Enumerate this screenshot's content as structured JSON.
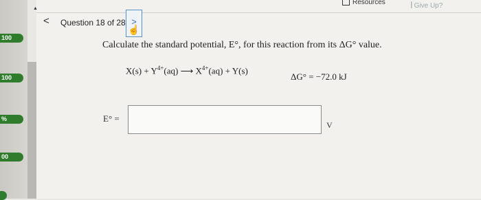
{
  "sidebar": {
    "scores": [
      "100",
      "100",
      "%",
      "00",
      ""
    ]
  },
  "header": {
    "resources_label": "Resources",
    "giveup_label": "Give Up?"
  },
  "nav": {
    "back_glyph": "<",
    "question_label": "Question 18 of 28",
    "next_glyph": ">"
  },
  "question": {
    "prompt": "Calculate the standard potential, E°, for this reaction from its ΔG° value.",
    "reaction_lhs": "X(s) + Y",
    "reaction_lhs_charge": "4+",
    "reaction_lhs_state": "(aq)",
    "arrow": "⟶",
    "reaction_rhs": "X",
    "reaction_rhs_charge": "4+",
    "reaction_rhs_tail": "(aq) + Y(s)",
    "delta_g": "ΔG° = −72.0 kJ"
  },
  "answer": {
    "label": "E° =",
    "value": "",
    "unit": "V"
  },
  "colors": {
    "score_green": "#2f7d2c",
    "accent_blue": "#5a8fc6"
  }
}
